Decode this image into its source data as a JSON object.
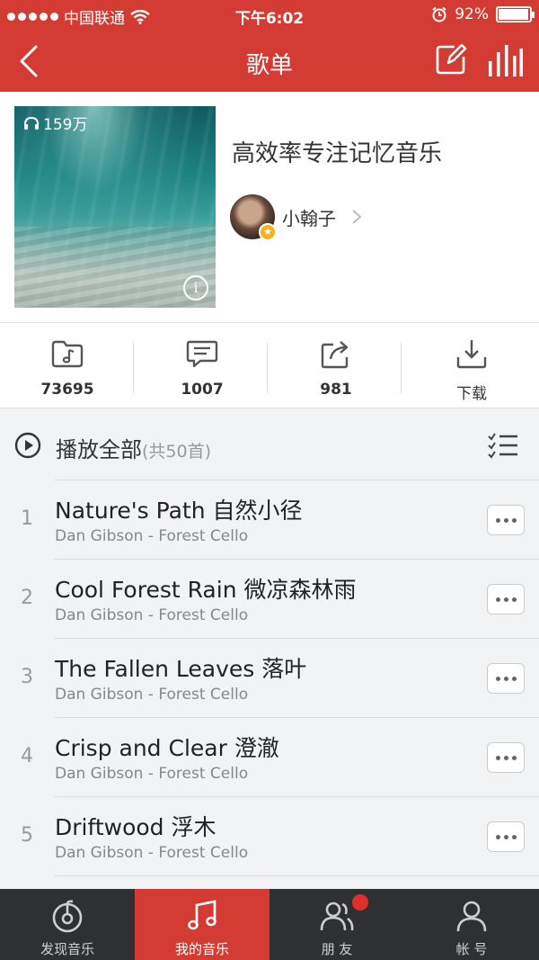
{
  "status_bar": {
    "carrier": "中国联通",
    "time": "下午6:02",
    "battery": "92%"
  },
  "nav": {
    "title": "歌单",
    "icons": [
      "back-icon",
      "edit-icon",
      "equalizer-icon"
    ]
  },
  "playlist": {
    "play_count": "159万",
    "title": "高效率专注记忆音乐",
    "creator": "小翰子"
  },
  "stats": [
    {
      "icon": "folder-music-icon",
      "value": "73695"
    },
    {
      "icon": "comment-icon",
      "value": "1007"
    },
    {
      "icon": "share-icon",
      "value": "981"
    },
    {
      "icon": "download-icon",
      "value": "下载"
    }
  ],
  "play_all": {
    "label": "播放全部",
    "count": "(共50首)"
  },
  "songs": [
    {
      "index": "1",
      "title": "Nature's Path 自然小径",
      "subtitle": "Dan Gibson - Forest  Cello"
    },
    {
      "index": "2",
      "title": "Cool Forest Rain 微凉森林雨",
      "subtitle": "Dan Gibson - Forest  Cello"
    },
    {
      "index": "3",
      "title": "The Fallen Leaves 落叶",
      "subtitle": "Dan Gibson - Forest  Cello"
    },
    {
      "index": "4",
      "title": "Crisp and Clear 澄澈",
      "subtitle": "Dan Gibson - Forest  Cello"
    },
    {
      "index": "5",
      "title": "Driftwood 浮木",
      "subtitle": "Dan Gibson - Forest  Cello"
    }
  ],
  "tabs": [
    {
      "label": "发现音乐",
      "icon": "discover-music-icon",
      "active": false
    },
    {
      "label": "我的音乐",
      "icon": "my-music-icon",
      "active": true
    },
    {
      "label": "朋 友",
      "icon": "friends-icon",
      "active": false
    },
    {
      "label": "帐 号",
      "icon": "account-icon",
      "active": false
    }
  ],
  "colors": {
    "brand_red": "#d43c33",
    "tab_bar": "#2f3032"
  }
}
